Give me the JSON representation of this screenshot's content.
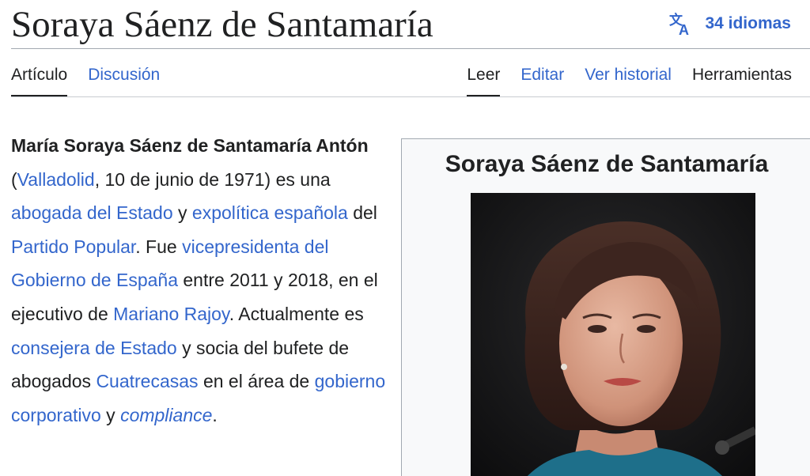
{
  "page": {
    "title": "Soraya Sáenz de Santamaría",
    "languages_label": "34 idiomas"
  },
  "tabs": {
    "left": [
      {
        "label": "Artículo"
      },
      {
        "label": "Discusión"
      }
    ],
    "right": [
      {
        "label": "Leer"
      },
      {
        "label": "Editar"
      },
      {
        "label": "Ver historial"
      },
      {
        "label": "Herramientas"
      }
    ]
  },
  "lead": {
    "name_bold": "María Soraya Sáenz de Santamaría Antón",
    "t1": " (",
    "link_valladolid": "Valladolid",
    "t2": ", 10 de junio de 1971) es una ",
    "link_abogada": "abogada del Estado",
    "t3": " y ",
    "link_expolitica": "expolítica española",
    "t4": " del ",
    "link_pp": "Partido Popular",
    "t5": ". Fue ",
    "link_vicepresidenta": "vicepresidenta del Gobierno de España",
    "t6": " entre 2011 y 2018, en el ejecutivo de ",
    "link_rajoy": "Mariano Rajoy",
    "t7": ". Actualmente es ",
    "link_consejera": "consejera de Estado",
    "t8": " y socia del bufete de abogados ",
    "link_cuatrecasas": "Cuatrecasas",
    "t9": " en el área de ",
    "link_gobierno": "gobierno corporativo",
    "t10": " y ",
    "link_compliance": "compliance",
    "t11": "."
  },
  "infobox": {
    "title": "Soraya Sáenz de Santamaría"
  },
  "colors": {
    "link": "#3366cc",
    "text": "#202122",
    "rule": "#a2a9b1",
    "infobox_bg": "#f8f9fa"
  },
  "icons": {
    "language": "translate-icon"
  }
}
